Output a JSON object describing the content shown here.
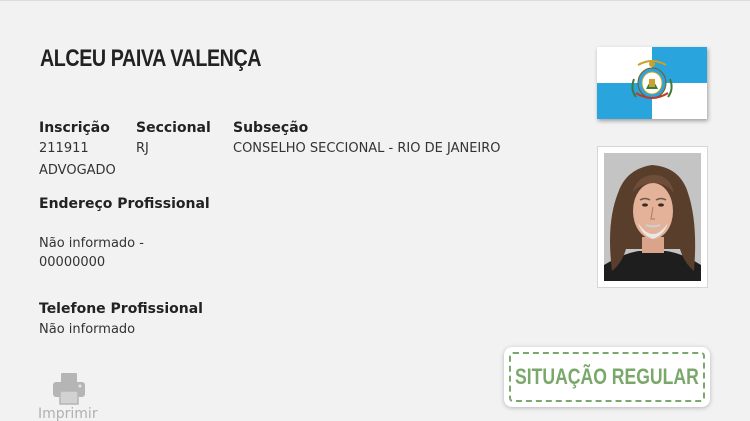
{
  "profile": {
    "name": "ALCEU PAIVA VALENÇA",
    "inscricao_label": "Inscrição",
    "inscricao_value": "211911",
    "seccional_label": "Seccional",
    "seccional_value": "RJ",
    "subsecao_label": "Subseção",
    "subsecao_value": "CONSELHO SECCIONAL - RIO DE JANEIRO",
    "tipo": "ADVOGADO",
    "endereco_label": "Endereço Profissional",
    "endereco_line1": "Não informado -",
    "endereco_line2": "00000000",
    "telefone_label": "Telefone Profissional",
    "telefone_value": "Não informado"
  },
  "status": {
    "text": "SITUAÇÃO REGULAR",
    "color": "#7aa86a"
  },
  "actions": {
    "print_label": "Imprimir",
    "print_icon": "printer-icon"
  },
  "flag": {
    "icon": "rio-de-janeiro-flag",
    "colors": [
      "#2aa4dc",
      "#ffffff"
    ]
  }
}
